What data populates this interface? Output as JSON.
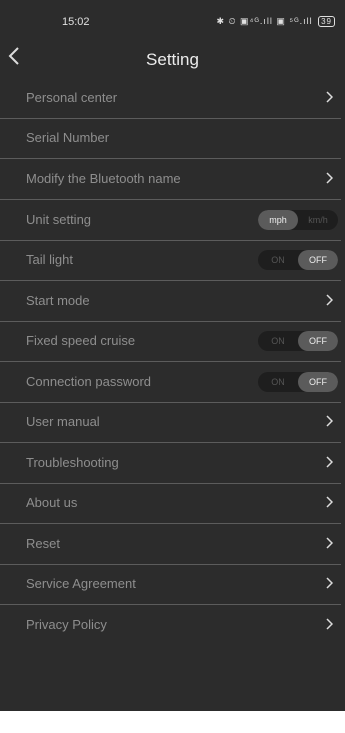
{
  "status": {
    "time": "15:02",
    "icons": "✱ ⏲ ▣⁴ᴳ.ıll ▣ ⁵ᴳ.ıll",
    "battery": "39"
  },
  "header": {
    "title": "Setting"
  },
  "rows": [
    {
      "label": "Personal center",
      "kind": "chevron"
    },
    {
      "label": "Serial Number",
      "kind": "none"
    },
    {
      "label": "Modify the Bluetooth name",
      "kind": "chevron"
    },
    {
      "label": "Unit setting",
      "kind": "segment",
      "options": [
        "mph",
        "km/h"
      ],
      "selected": "mph"
    },
    {
      "label": "Tail light",
      "kind": "segment",
      "options": [
        "ON",
        "OFF"
      ],
      "selected": "OFF"
    },
    {
      "label": "Start mode",
      "kind": "chevron"
    },
    {
      "label": "Fixed speed cruise",
      "kind": "segment",
      "options": [
        "ON",
        "OFF"
      ],
      "selected": "OFF"
    },
    {
      "label": "Connection password",
      "kind": "segment",
      "options": [
        "ON",
        "OFF"
      ],
      "selected": "OFF"
    },
    {
      "label": "User manual",
      "kind": "chevron"
    },
    {
      "label": "Troubleshooting",
      "kind": "chevron"
    },
    {
      "label": "About us",
      "kind": "chevron"
    },
    {
      "label": "Reset",
      "kind": "chevron"
    },
    {
      "label": "Service Agreement",
      "kind": "chevron"
    },
    {
      "label": "Privacy Policy",
      "kind": "chevron"
    }
  ]
}
